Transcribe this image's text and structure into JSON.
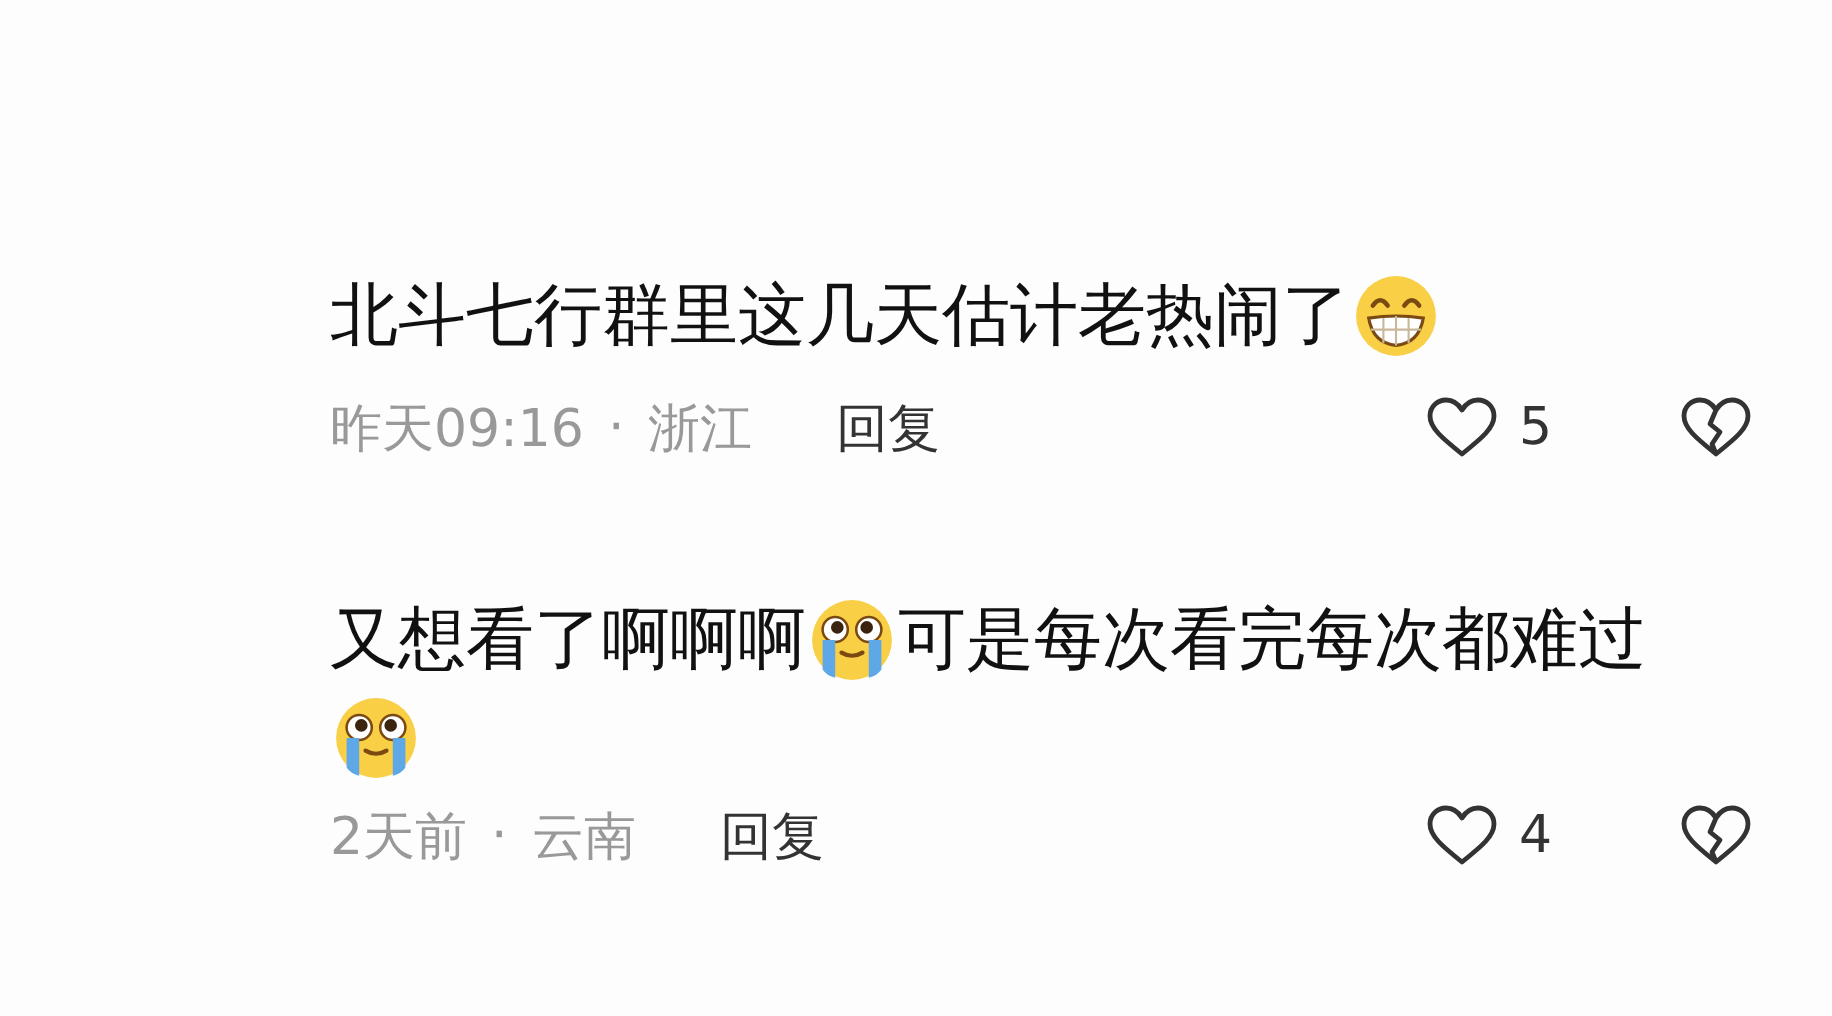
{
  "comments": [
    {
      "parts": [
        {
          "kind": "text",
          "text": "北斗七行群里这几天估计老热闹了"
        },
        {
          "kind": "grin"
        }
      ],
      "time": "昨天09:16",
      "separator": "·",
      "location": "浙江",
      "reply": "回复",
      "likes": "5"
    },
    {
      "parts": [
        {
          "kind": "text",
          "text": "又想看了啊啊啊"
        },
        {
          "kind": "crying"
        },
        {
          "kind": "text",
          "text": "可是每次看完每次都难过"
        },
        {
          "kind": "crying"
        }
      ],
      "time": "2天前",
      "separator": "·",
      "location": "云南",
      "reply": "回复",
      "likes": "4"
    }
  ]
}
